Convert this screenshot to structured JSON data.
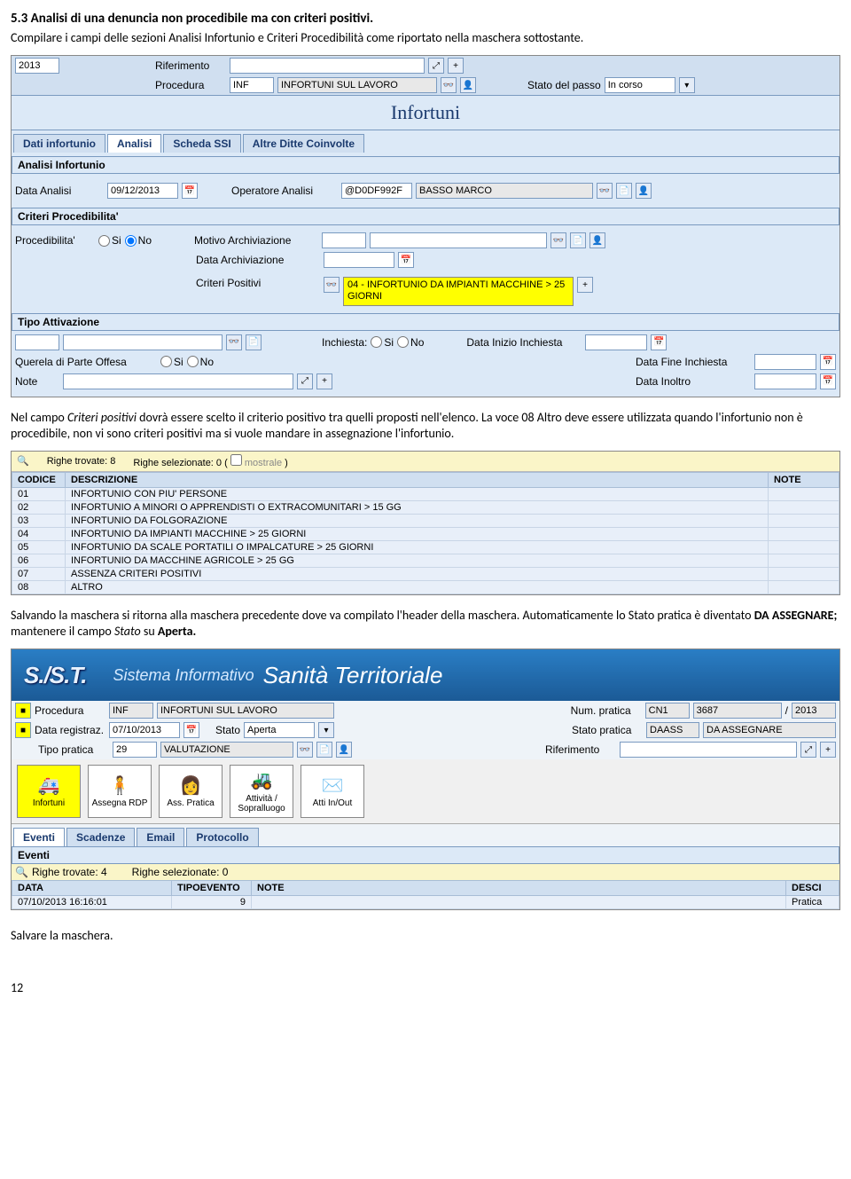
{
  "heading": "5.3 Analisi di una denuncia non procedibile ma con criteri positivi.",
  "para1": "Compilare i campi delle sezioni Analisi Infortunio e Criteri Procedibilità come riportato nella maschera sottostante.",
  "panel1": {
    "riferimento_lbl": "Riferimento",
    "procedura_lbl": "Procedura",
    "anno": "2013",
    "proc_code": "INF",
    "proc_desc": "INFORTUNI SUL LAVORO",
    "stato_passo_lbl": "Stato del passo",
    "stato_passo_val": "In corso",
    "title": "Infortuni",
    "tabs": [
      "Dati infortunio",
      "Analisi",
      "Scheda SSI",
      "Altre Ditte Coinvolte"
    ],
    "sec_analisi": "Analisi Infortunio",
    "data_analisi_lbl": "Data Analisi",
    "data_analisi_val": "09/12/2013",
    "op_analisi_lbl": "Operatore Analisi",
    "op_code": "@D0DF992F",
    "op_name": "BASSO MARCO",
    "sec_criteri": "Criteri Procedibilita'",
    "proced_lbl": "Procedibilita'",
    "si": "Si",
    "no": "No",
    "motivo_lbl": "Motivo Archiviazione",
    "data_arch_lbl": "Data Archiviazione",
    "crit_pos_lbl": "Criteri Positivi",
    "crit_pos_val": "04 - INFORTUNIO DA IMPIANTI MACCHINE  > 25 GIORNI",
    "sec_tipo": "Tipo Attivazione",
    "inchiesta_lbl": "Inchiesta:",
    "data_inizio_lbl": "Data Inizio Inchiesta",
    "querela_lbl": "Querela di Parte Offesa",
    "data_fine_lbl": "Data Fine Inchiesta",
    "note_lbl": "Note",
    "data_inoltro_lbl": "Data Inoltro"
  },
  "para2a": "Nel campo ",
  "para2b": "Criteri positivi",
  "para2c": " dovrà essere scelto il criterio positivo tra quelli proposti nell'elenco. La voce 08 Altro deve essere utilizzata quando l'infortunio non è procedibile, non vi sono criteri positivi ma si vuole mandare in assegnazione l'infortunio.",
  "table": {
    "righe_trovate_lbl": "Righe trovate: 8",
    "righe_sel_lbl": "Righe selezionate: 0 (",
    "mostrale": "mostrale",
    "close": ")",
    "col_codice": "CODICE",
    "col_desc": "DESCRIZIONE",
    "col_note": "NOTE",
    "rows": [
      {
        "c": "01",
        "d": "INFORTUNIO CON PIU' PERSONE"
      },
      {
        "c": "02",
        "d": "INFORTUNIO A MINORI O APPRENDISTI O EXTRACOMUNITARI > 15 GG"
      },
      {
        "c": "03",
        "d": "INFORTUNIO DA FOLGORAZIONE"
      },
      {
        "c": "04",
        "d": "INFORTUNIO DA IMPIANTI MACCHINE  > 25 GIORNI"
      },
      {
        "c": "05",
        "d": "INFORTUNIO DA SCALE PORTATILI O IMPALCATURE  > 25 GIORNI"
      },
      {
        "c": "06",
        "d": "INFORTUNIO DA MACCHINE AGRICOLE > 25 GG"
      },
      {
        "c": "07",
        "d": "ASSENZA CRITERI POSITIVI"
      },
      {
        "c": "08",
        "d": "ALTRO"
      }
    ]
  },
  "para3a": "Salvando la maschera si ritorna alla maschera precedente dove va compilato l'header della maschera. Automaticamente lo Stato pratica è diventato ",
  "para3b": "DA ASSEGNARE; ",
  "para3c": "mantenere il campo ",
  "para3d": "Stato",
  "para3e": " su ",
  "para3f": "Aperta.",
  "panel2": {
    "logo": "S./S.T.",
    "sub": "Sistema Informativo",
    "main": "Sanità Territoriale",
    "procedura_lbl": "Procedura",
    "proc_code": "INF",
    "proc_desc": "INFORTUNI SUL LAVORO",
    "num_pratica_lbl": "Num. pratica",
    "num_p1": "CN1",
    "num_p2": "3687",
    "num_p3": "2013",
    "data_reg_lbl": "Data registraz.",
    "data_reg_val": "07/10/2013",
    "stato_lbl": "Stato",
    "stato_val": "Aperta",
    "stato_prat_lbl": "Stato pratica",
    "stato_prat_val": "DAASS",
    "stato_prat_desc": "DA ASSEGNARE",
    "tipo_lbl": "Tipo pratica",
    "tipo_val": "29",
    "tipo_desc": "VALUTAZIONE",
    "rif_lbl": "Riferimento",
    "btns": [
      "Infortuni",
      "Assegna RDP",
      "Ass. Pratica",
      "Attività / Sopralluogo",
      "Atti In/Out"
    ],
    "tabs": [
      "Eventi",
      "Scadenze",
      "Email",
      "Protocollo"
    ],
    "eventi_title": "Eventi",
    "righe_trovate": "Righe trovate: 4",
    "righe_sel": "Righe selezionate: 0",
    "col_data": "DATA",
    "col_tipo": "TIPOEVENTO",
    "col_note": "NOTE",
    "col_desc": "DESCI",
    "r_data": "07/10/2013 16:16:01",
    "r_tipo": "9",
    "r_note": "",
    "r_desc": "Pratica"
  },
  "para4": "Salvare la maschera.",
  "pagenum": "12"
}
